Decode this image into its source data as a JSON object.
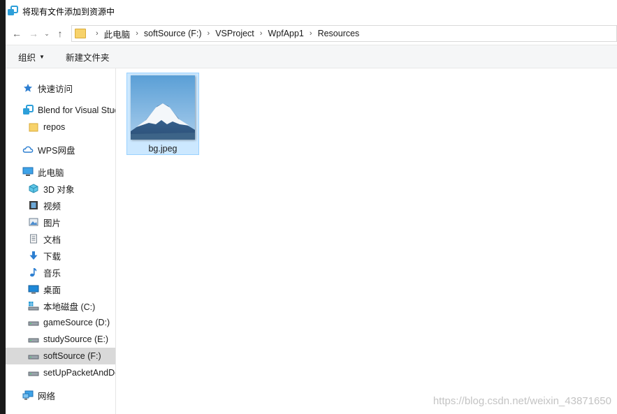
{
  "window": {
    "title": "将现有文件添加到资源中"
  },
  "nav": {
    "back": "←",
    "forward": "→",
    "recent": "⌄",
    "up": "↑"
  },
  "breadcrumb": [
    "此电脑",
    "softSource (F:)",
    "VSProject",
    "WpfApp1",
    "Resources"
  ],
  "toolbar": {
    "organize_label": "组织",
    "new_folder_label": "新建文件夹"
  },
  "sidebar": {
    "items": [
      {
        "label": "快速访问",
        "icon": "star-icon"
      },
      {
        "label": "Blend for Visual Studio",
        "icon": "blend-icon"
      },
      {
        "label": "repos",
        "icon": "folder-icon"
      },
      {
        "label": "WPS网盘",
        "icon": "cloud-icon"
      },
      {
        "label": "此电脑",
        "icon": "computer-icon"
      },
      {
        "label": "3D 对象",
        "icon": "cube-icon"
      },
      {
        "label": "视频",
        "icon": "video-icon"
      },
      {
        "label": "图片",
        "icon": "picture-icon"
      },
      {
        "label": "文档",
        "icon": "document-icon"
      },
      {
        "label": "下载",
        "icon": "download-icon"
      },
      {
        "label": "音乐",
        "icon": "music-icon"
      },
      {
        "label": "桌面",
        "icon": "desktop-icon"
      },
      {
        "label": "本地磁盘 (C:)",
        "icon": "system-drive-icon"
      },
      {
        "label": "gameSource (D:)",
        "icon": "drive-icon"
      },
      {
        "label": "studySource (E:)",
        "icon": "drive-icon"
      },
      {
        "label": "softSource (F:)",
        "icon": "drive-icon"
      },
      {
        "label": "setUpPacketAndDocument (G:)",
        "icon": "drive-icon"
      },
      {
        "label": "网络",
        "icon": "network-icon"
      }
    ],
    "selected": "softSource (F:)"
  },
  "files": [
    {
      "name": "bg.jpeg"
    }
  ],
  "watermark": "https://blog.csdn.net/weixin_43871650",
  "colors": {
    "selection": "#cce8ff",
    "selection_border": "#99d1ff",
    "sidebar_selected": "#d9d9d9",
    "accent": "#0078d7"
  }
}
